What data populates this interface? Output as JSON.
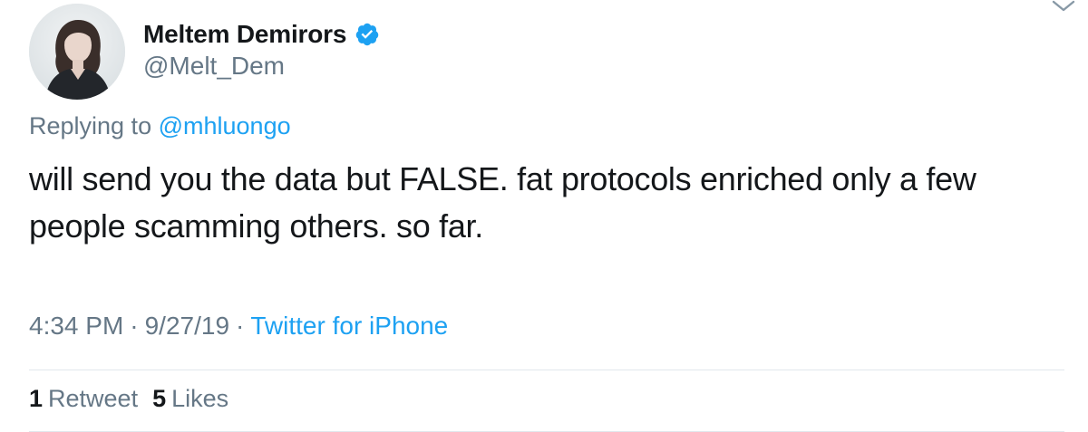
{
  "author": {
    "display_name": "Meltem Demirors",
    "handle": "@Melt_Dem",
    "verified": true,
    "verified_color": "#1da1f2"
  },
  "icons": {
    "avatar": "avatar",
    "verified": "verified-badge-icon",
    "menu": "chevron-down-icon"
  },
  "reply": {
    "prefix": "Replying to",
    "mention": "@mhluongo"
  },
  "tweet": {
    "text_line_1": "will send you the data but FALSE. fat protocols enriched only a few",
    "text_line_2": "people scamming others. so far."
  },
  "meta": {
    "time": "4:34 PM",
    "separator": "·",
    "date": "9/27/19",
    "source": "Twitter for iPhone"
  },
  "stats": {
    "retweets_count": "1",
    "retweets_label": "Retweet",
    "likes_count": "5",
    "likes_label": "Likes"
  },
  "colors": {
    "text": "#14171a",
    "secondary": "#657786",
    "link": "#1da1f2",
    "divider": "#e1e8ed"
  }
}
